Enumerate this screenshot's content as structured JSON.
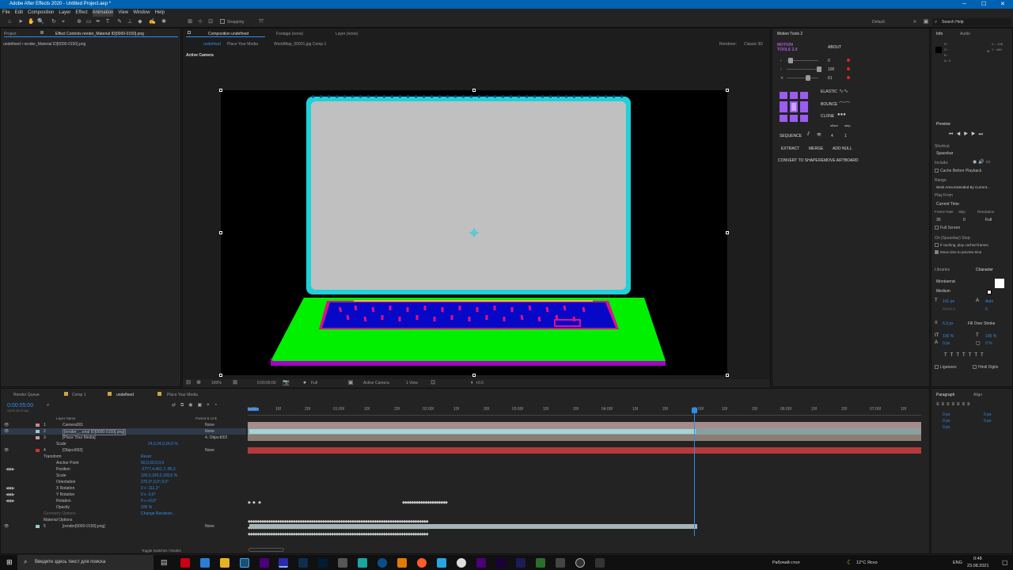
{
  "window": {
    "title": "Adobe After Effects 2020 - Untitled Project.aep *",
    "minimize": "─",
    "maximize": "☐",
    "close": "✕"
  },
  "menu": [
    "File",
    "Edit",
    "Composition",
    "Layer",
    "Effect",
    "Animation",
    "View",
    "Window",
    "Help"
  ],
  "toolbar": {
    "snapping": "Snapping",
    "workspace": "Default",
    "search": "Search Help"
  },
  "project_panel": {
    "tab_project": "Project",
    "tab_effect": "Effect Controls render_Material ID[0000-0150].png",
    "path": "undefined • render_Material ID[0000-0150].png"
  },
  "comp_panel": {
    "tab": "Composition undefined",
    "footage": "Footage (none)",
    "layer": "Layer (none)",
    "crumbs": [
      "undefined",
      "Place Your Media",
      "WorldMap_00001.jpg Comp 1"
    ],
    "renderer": "Renderer:",
    "renderer_val": "Classic 3D",
    "active_camera": "Active Camera"
  },
  "viewer_bar": {
    "zoom": "100%",
    "time": "0:00:05:00",
    "res": "Full",
    "camera": "Active Camera",
    "views": "1 View",
    "offset": "+0.0"
  },
  "motion_tools": {
    "title": "Motion Tools 2",
    "logo": "MOTION TOOLS 2.0",
    "about": "ABOUT",
    "s1": "0",
    "s2": "100",
    "s3": "61",
    "elastic": "ELASTIC",
    "bounce": "BOUNCE",
    "clone": "CLONE",
    "offset": "offset",
    "step": "step",
    "sequence": "SEQUENCE",
    "seq_a": "4",
    "seq_b": "1",
    "extract": "EXTRACT",
    "merge": "MERGE",
    "add_null": "ADD NULL",
    "convert": "CONVERT TO SHAPE",
    "remove": "REMOVE ARTBOARD"
  },
  "info": {
    "tab_info": "Info",
    "tab_audio": "Audio",
    "r": "R :",
    "g": "G :",
    "b": "B :",
    "a": "A : 0",
    "x": "X : -105",
    "y": "Y : 446"
  },
  "preview": {
    "title": "Preview",
    "shortcut": "Shortcut",
    "spacebar": "Spacebar",
    "include": "Include:",
    "cache": "Cache Before Playback",
    "range": "Range",
    "range_val": "Work Area Extended By Current...",
    "play_from": "Play From",
    "play_from_val": "Current Time",
    "frame_rate": "Frame Rate",
    "skip": "Skip",
    "resolution": "Resolution",
    "fr_val": "30",
    "skip_val": "0",
    "res_val": "Full",
    "full_screen": "Full Screen",
    "on_stop": "On (Spacebar) Stop:",
    "if_caching": "If caching, play cached frames",
    "move_time": "Move time to preview time"
  },
  "character": {
    "libraries": "Libraries",
    "tab": "Character",
    "font": "Montserrat",
    "style": "Medium",
    "size": "141 px",
    "leading": "Auto",
    "tracking": "Metrics",
    "kern": "0",
    "stroke": "6,3 px",
    "stroke_mode": "Fill Over Stroke",
    "vscale": "100 %",
    "hscale": "100 %",
    "baseline": "0 px",
    "tsume": "0 %",
    "ligatures": "Ligatures",
    "hindi": "Hindi Digits"
  },
  "paragraph": {
    "tab": "Paragraph",
    "align": "Align",
    "v1": "0 px",
    "v2": "0 px",
    "v3": "0 px",
    "v4": "0 px",
    "v5": "0 px"
  },
  "timeline": {
    "tabs": [
      "Render Queue",
      "Comp 1",
      "undefined",
      "Place Your Media"
    ],
    "timecode": "0:00:05:00",
    "fps": "00150 (30.00 fps)",
    "col_name": "Layer Name",
    "col_parent": "Parent & Link",
    "ruler": [
      "0:00f",
      "10f",
      "20f",
      "01:00f",
      "10f",
      "20f",
      "02:00f",
      "10f",
      "20f",
      "03:00f",
      "10f",
      "20f",
      "04:00f",
      "10f",
      "20f",
      "05:00f",
      "10f",
      "20f",
      "06:00f",
      "10f",
      "20f",
      "07:00f",
      "10f"
    ],
    "layers": [
      {
        "num": "1",
        "name": "Camera001",
        "parent": "None"
      },
      {
        "num": "2",
        "name": "[render_...erial ID[0000-0150].png]",
        "parent": "None"
      },
      {
        "num": "3",
        "name": "[Place Your Media]",
        "parent": "4. Object002"
      },
      {
        "sub": "Scale",
        "val": "24,0,24,0,24,0 %"
      },
      {
        "num": "4",
        "name": "[Object002]",
        "parent": "None"
      },
      {
        "sub": "Transform",
        "val": "Reset"
      },
      {
        "sub": "Anchor Point",
        "val": "50,0,50,0,0,0"
      },
      {
        "sub": "Position",
        "val": "-2777,4,461,7,-86,3"
      },
      {
        "sub": "Scale",
        "val": "100,0,100,0,100,0 %"
      },
      {
        "sub": "Orientation",
        "val": "270,0°,0,0°,0,0°"
      },
      {
        "sub": "X Rotation",
        "val": "0 x -111,1°"
      },
      {
        "sub": "Y Rotation",
        "val": "0 x -0,0°"
      },
      {
        "sub": "Rotation",
        "val": "0 x +0,0°"
      },
      {
        "sub": "Opacity",
        "val": "100 %"
      },
      {
        "sub": "Geometry Options",
        "val": "Change Renderer..."
      },
      {
        "sub": "Material Options",
        "val": ""
      },
      {
        "num": "5",
        "name": "[render[0000-0150].png]",
        "parent": "None"
      }
    ],
    "toggle": "Toggle Switches / Modes"
  },
  "taskbar": {
    "search": "Введите здесь текст для поиска",
    "desktop": "Рабочий стол",
    "weather": "12°C Ясно",
    "lang": "ENG",
    "time": "0:48",
    "date": "23.08.2021"
  },
  "colors": {
    "title_blue": "#0063b1",
    "accent_blue": "#2d8ceb",
    "laptop_screen": "#c0c0c0",
    "laptop_rim": "#1fd1d8",
    "laptop_base": "#00f000",
    "keyboard": "#0707c8",
    "keys": "#e0108a"
  }
}
